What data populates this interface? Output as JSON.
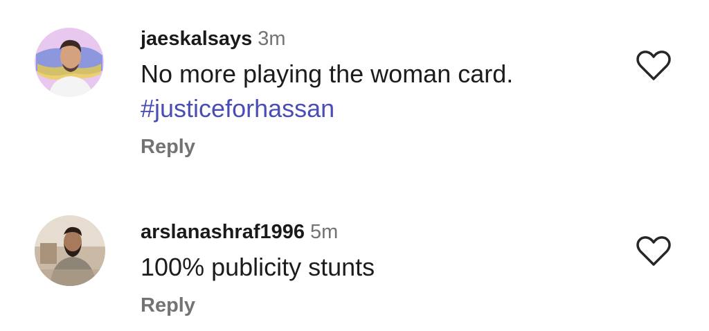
{
  "comments": [
    {
      "username": "jaeskalsays",
      "time": "3m",
      "text": "No more playing the woman card.",
      "hashtag": "#justiceforhassan",
      "reply_label": "Reply",
      "avatar_icon": "avatar-photo-icon",
      "like_icon": "heart-outline-icon"
    },
    {
      "username": "arslanashraf1996",
      "time": "5m",
      "text": "100% publicity stunts",
      "reply_label": "Reply",
      "avatar_icon": "avatar-photo-icon",
      "like_icon": "heart-outline-icon"
    }
  ],
  "colors": {
    "username": "#1a1a1a",
    "muted": "#737373",
    "hashtag": "#4a4db5",
    "heart_stroke": "#262626"
  }
}
